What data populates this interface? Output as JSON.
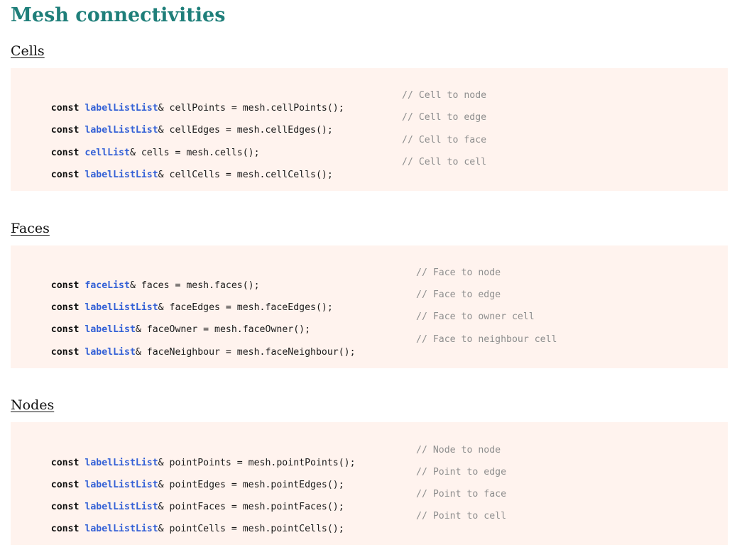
{
  "page": {
    "title": "Mesh connectivities"
  },
  "sections": [
    {
      "heading": "Cells",
      "lines": [
        {
          "keyword": "const",
          "type": "labelListList",
          "statement": "& cellPoints = mesh.cellPoints();",
          "comment": "// Cell to node"
        },
        {
          "keyword": "const",
          "type": "labelListList",
          "statement": "& cellEdges = mesh.cellEdges();",
          "comment": "// Cell to edge"
        },
        {
          "keyword": "const",
          "type": "cellList",
          "statement": "& cells = mesh.cells();",
          "comment": "// Cell to face"
        },
        {
          "keyword": "const",
          "type": "labelListList",
          "statement": "& cellCells = mesh.cellCells();",
          "comment": "// Cell to cell"
        }
      ]
    },
    {
      "heading": "Faces",
      "lines": [
        {
          "keyword": "const",
          "type": "faceList",
          "statement": "& faces = mesh.faces();",
          "comment": "// Face to node"
        },
        {
          "keyword": "const",
          "type": "labelListList",
          "statement": "& faceEdges = mesh.faceEdges();",
          "comment": "// Face to edge"
        },
        {
          "keyword": "const",
          "type": "labelList",
          "statement": "& faceOwner = mesh.faceOwner();",
          "comment": "// Face to owner cell"
        },
        {
          "keyword": "const",
          "type": "labelList",
          "statement": "& faceNeighbour = mesh.faceNeighbour();",
          "comment": "// Face to neighbour cell"
        }
      ]
    },
    {
      "heading": "Nodes",
      "lines": [
        {
          "keyword": "const",
          "type": "labelListList",
          "statement": "& pointPoints = mesh.pointPoints();",
          "comment": "// Node to node"
        },
        {
          "keyword": "const",
          "type": "labelListList",
          "statement": "& pointEdges = mesh.pointEdges();",
          "comment": "// Point to edge"
        },
        {
          "keyword": "const",
          "type": "labelListList",
          "statement": "& pointFaces = mesh.pointFaces();",
          "comment": "// Point to face"
        },
        {
          "keyword": "const",
          "type": "labelListList",
          "statement": "& pointCells = mesh.pointCells();",
          "comment": "// Point to cell"
        }
      ]
    }
  ]
}
